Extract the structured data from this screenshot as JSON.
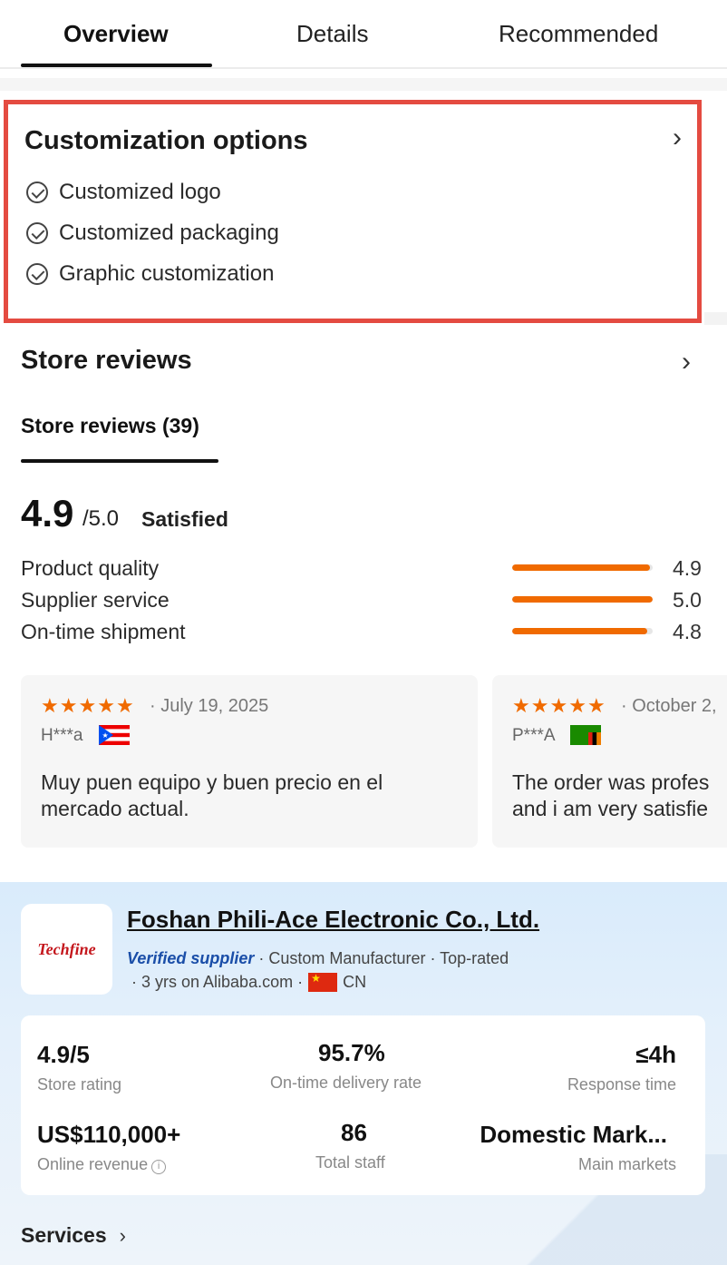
{
  "tabs": [
    {
      "label": "Overview",
      "active": true
    },
    {
      "label": "Details",
      "active": false
    },
    {
      "label": "Recommended",
      "active": false
    }
  ],
  "customization": {
    "title": "Customization options",
    "options": [
      "Customized logo",
      "Customized packaging",
      "Graphic customization"
    ],
    "highlight_color": "#e44b41"
  },
  "store_reviews": {
    "title": "Store reviews",
    "subtab": "Store reviews (39)",
    "score": "4.9",
    "score_max": "/5.0",
    "score_word": "Satisfied",
    "metrics": [
      {
        "label": "Product quality",
        "value": "4.9",
        "fraction": 0.98
      },
      {
        "label": "Supplier service",
        "value": "5.0",
        "fraction": 1.0
      },
      {
        "label": "On-time shipment",
        "value": "4.8",
        "fraction": 0.96
      }
    ],
    "accent_color": "#f06a00",
    "reviews": [
      {
        "stars": 5,
        "date": "· July 19, 2025",
        "user": "H***a",
        "flag": "puerto-rico-flag",
        "text_line1": "Muy puen equipo y buen precio en el",
        "text_line2": "mercado actual."
      },
      {
        "stars": 5,
        "date": "· October 2,",
        "user": "P***A",
        "flag": "zambia-flag",
        "text_line1": "The order was profes",
        "text_line2": "and i am very satisfie"
      }
    ]
  },
  "supplier": {
    "logo_text": "Techfine",
    "name": "Foshan Phili-Ace Electronic Co., Ltd.",
    "verified": "Verified supplier",
    "tags": "· Custom Manufacturer · Top-rated",
    "years": "· 3 yrs on Alibaba.com ·",
    "country": "CN",
    "stats": [
      {
        "value": "4.9/5",
        "label": "Store rating"
      },
      {
        "value": "95.7%",
        "label": "On-time delivery rate"
      },
      {
        "value": "≤4h",
        "label": "Response time"
      },
      {
        "value": "US$110,000+",
        "label": "Online revenue"
      },
      {
        "value": "86",
        "label": "Total staff"
      },
      {
        "value": "Domestic Mark...",
        "label": "Main markets"
      }
    ],
    "services_label": "Services"
  }
}
